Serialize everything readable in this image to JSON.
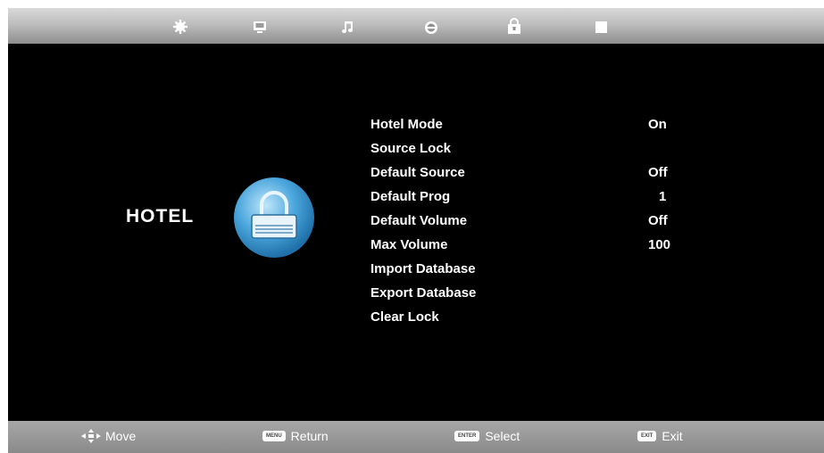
{
  "top_tabs": [
    {
      "icon": "picture-gear-icon"
    },
    {
      "icon": "tv-screen-icon"
    },
    {
      "icon": "music-note-icon"
    },
    {
      "icon": "clock-icon"
    },
    {
      "icon": "lock-bag-icon"
    },
    {
      "icon": "square-icon"
    }
  ],
  "page": {
    "title": "HOTEL",
    "icon": "hotel-lock-icon"
  },
  "menu": {
    "items": [
      {
        "label": "Hotel Mode",
        "value": "On"
      },
      {
        "label": "Source Lock",
        "value": ""
      },
      {
        "label": "Default Source",
        "value": "Off"
      },
      {
        "label": "Default Prog",
        "value": "1"
      },
      {
        "label": "Default Volume",
        "value": "Off"
      },
      {
        "label": "Max Volume",
        "value": "100"
      },
      {
        "label": "Import Database",
        "value": ""
      },
      {
        "label": "Export Database",
        "value": ""
      },
      {
        "label": "Clear Lock",
        "value": ""
      }
    ]
  },
  "footer": {
    "move": {
      "label": "Move",
      "icon": "dpad-icon"
    },
    "return": {
      "key": "MENU",
      "label": "Return"
    },
    "select": {
      "key": "ENTER",
      "label": "Select"
    },
    "exit": {
      "key": "EXIT",
      "label": "Exit"
    }
  },
  "colors": {
    "background": "#000000",
    "bar": "#a0a0a0",
    "text": "#ffffff",
    "icon_blue": "#3a8fc9"
  }
}
